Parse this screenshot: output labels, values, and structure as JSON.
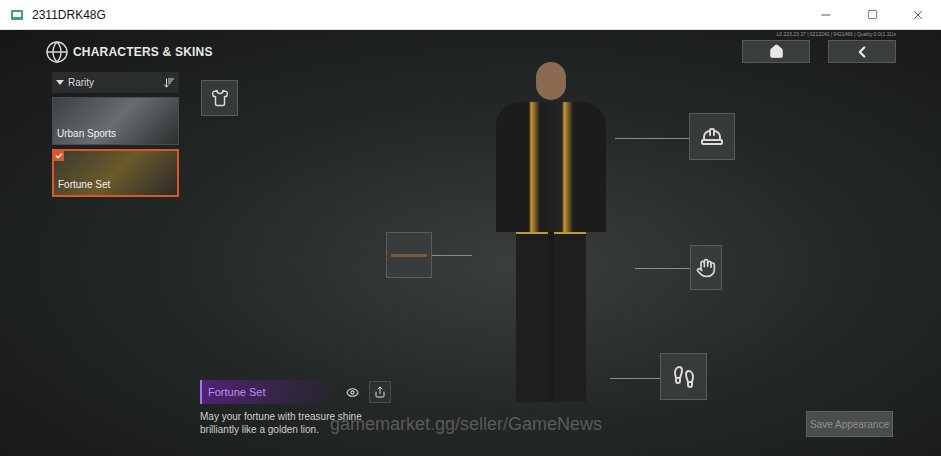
{
  "window": {
    "title": "2311DRK48G"
  },
  "header": {
    "title": "CHARACTERS & SKINS",
    "debug": "L0.223.23:37 | 0212240 | 9421466 | Quality:0.0(1.11)s"
  },
  "filter": {
    "label": "Rarity"
  },
  "skins": [
    {
      "name": "Urban Sports",
      "selected": false
    },
    {
      "name": "Fortune Set",
      "selected": true
    }
  ],
  "detail": {
    "name": "Fortune Set",
    "description_lines": [
      "May your fortune with treasure shine",
      "brilliantly like a golden lion."
    ]
  },
  "watermark": "gamemarket.gg/seller/GameNews",
  "save_button": {
    "label": "Save Appearance",
    "disabled": true
  }
}
